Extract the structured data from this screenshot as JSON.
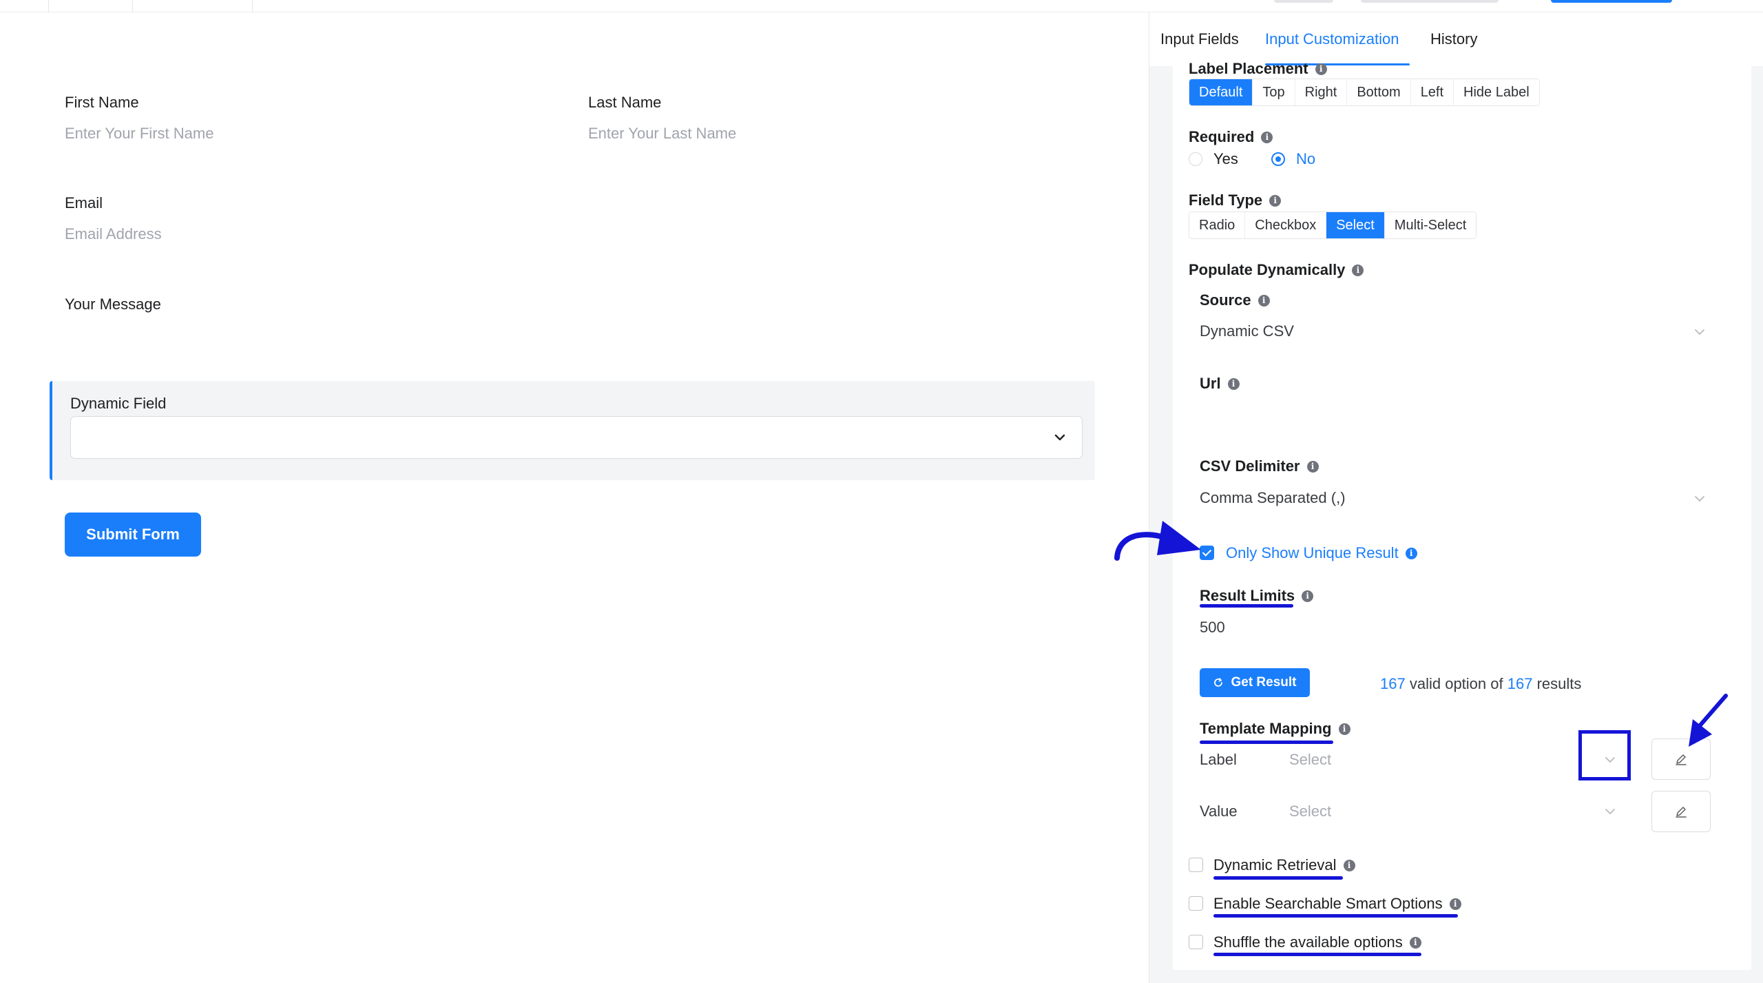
{
  "tabs": [
    {
      "label": "Input Fields"
    },
    {
      "label": "Input Customization"
    },
    {
      "label": "History"
    }
  ],
  "form": {
    "first_name": {
      "label": "First Name",
      "placeholder": "Enter Your First Name"
    },
    "last_name": {
      "label": "Last Name",
      "placeholder": "Enter Your Last Name"
    },
    "email": {
      "label": "Email",
      "placeholder": "Email Address"
    },
    "message": {
      "label": "Your Message"
    },
    "dynamic_field": {
      "label": "Dynamic Field"
    },
    "submit_label": "Submit Form"
  },
  "settings": {
    "label_placement": {
      "label": "Label Placement",
      "options": [
        "Default",
        "Top",
        "Right",
        "Bottom",
        "Left",
        "Hide Label"
      ],
      "selected": "Default"
    },
    "required": {
      "label": "Required",
      "yes": "Yes",
      "no": "No",
      "selected": "No"
    },
    "field_type": {
      "label": "Field Type",
      "options": [
        "Radio",
        "Checkbox",
        "Select",
        "Multi-Select"
      ],
      "selected": "Select"
    },
    "populate": {
      "label": "Populate Dynamically",
      "source": {
        "label": "Source",
        "value": "Dynamic CSV"
      },
      "url": {
        "label": "Url"
      },
      "csv_delimiter": {
        "label": "CSV Delimiter",
        "value": "Comma Separated (,)"
      },
      "unique": {
        "label": "Only Show Unique Result",
        "checked": true
      },
      "result_limits": {
        "label": "Result Limits",
        "value": "500"
      },
      "get_result": "Get Result",
      "result_info": {
        "valid": "167",
        "middle": "valid option of",
        "total": "167",
        "suffix": "results"
      },
      "template_mapping": {
        "label": "Template Mapping",
        "rows": [
          {
            "name": "Label",
            "placeholder": "Select"
          },
          {
            "name": "Value",
            "placeholder": "Select"
          }
        ]
      }
    },
    "dynamic_retrieval": {
      "label": "Dynamic Retrieval",
      "checked": false
    },
    "searchable_smart": {
      "label": "Enable Searchable Smart Options",
      "checked": false
    },
    "shuffle": {
      "label": "Shuffle the available options",
      "checked": false
    }
  },
  "colors": {
    "accent": "#1a7efb",
    "annotation": "#1414d6"
  },
  "icons": {
    "info": "info-icon",
    "chevron": "chevron-down-icon",
    "refresh": "refresh-icon",
    "edit": "pencil-icon"
  }
}
